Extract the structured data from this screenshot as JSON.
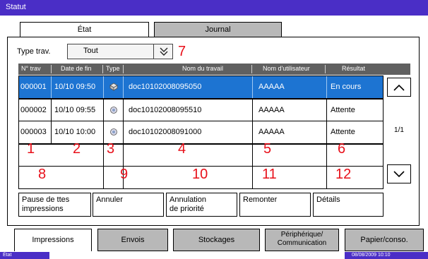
{
  "window": {
    "title": "Statut"
  },
  "tabs": {
    "status": "État",
    "journal": "Journal"
  },
  "filter": {
    "label": "Type trav.",
    "value": "Tout"
  },
  "annotations": [
    "7",
    "1",
    "2",
    "3",
    "4",
    "5",
    "6",
    "8",
    "9",
    "10",
    "11",
    "12"
  ],
  "table": {
    "headers": [
      "N° trav",
      "Date de fin",
      "Type",
      "Nom du travail",
      "Nom d'utilisateur",
      "Résultat"
    ],
    "rows": [
      {
        "no": "000001",
        "date": "10/10 09:50",
        "job": "doc10102008095050",
        "user": "AAAAA",
        "result": "En cours",
        "selected": true
      },
      {
        "no": "000002",
        "date": "10/10 09:55",
        "job": "doc10102008095510",
        "user": "AAAAA",
        "result": "Attente",
        "selected": false
      },
      {
        "no": "000003",
        "date": "10/10 10:00",
        "job": "doc10102008091000",
        "user": "AAAAA",
        "result": "Attente",
        "selected": false
      }
    ],
    "page": "1/1"
  },
  "actions": {
    "pause": [
      "Pause de ttes",
      "impressions"
    ],
    "cancel": "Annuler",
    "priority": [
      "Annulation",
      "de priorité"
    ],
    "up": "Remonter",
    "details": "Détails"
  },
  "bottom_tabs": {
    "impressions": "Impressions",
    "envois": "Envois",
    "stockages": "Stockages",
    "peripherique": [
      "Périphérique/",
      "Communication"
    ],
    "papier": "Papier/conso."
  },
  "status_bar": {
    "left": "État",
    "datetime": "08/08/2009  10:10"
  }
}
